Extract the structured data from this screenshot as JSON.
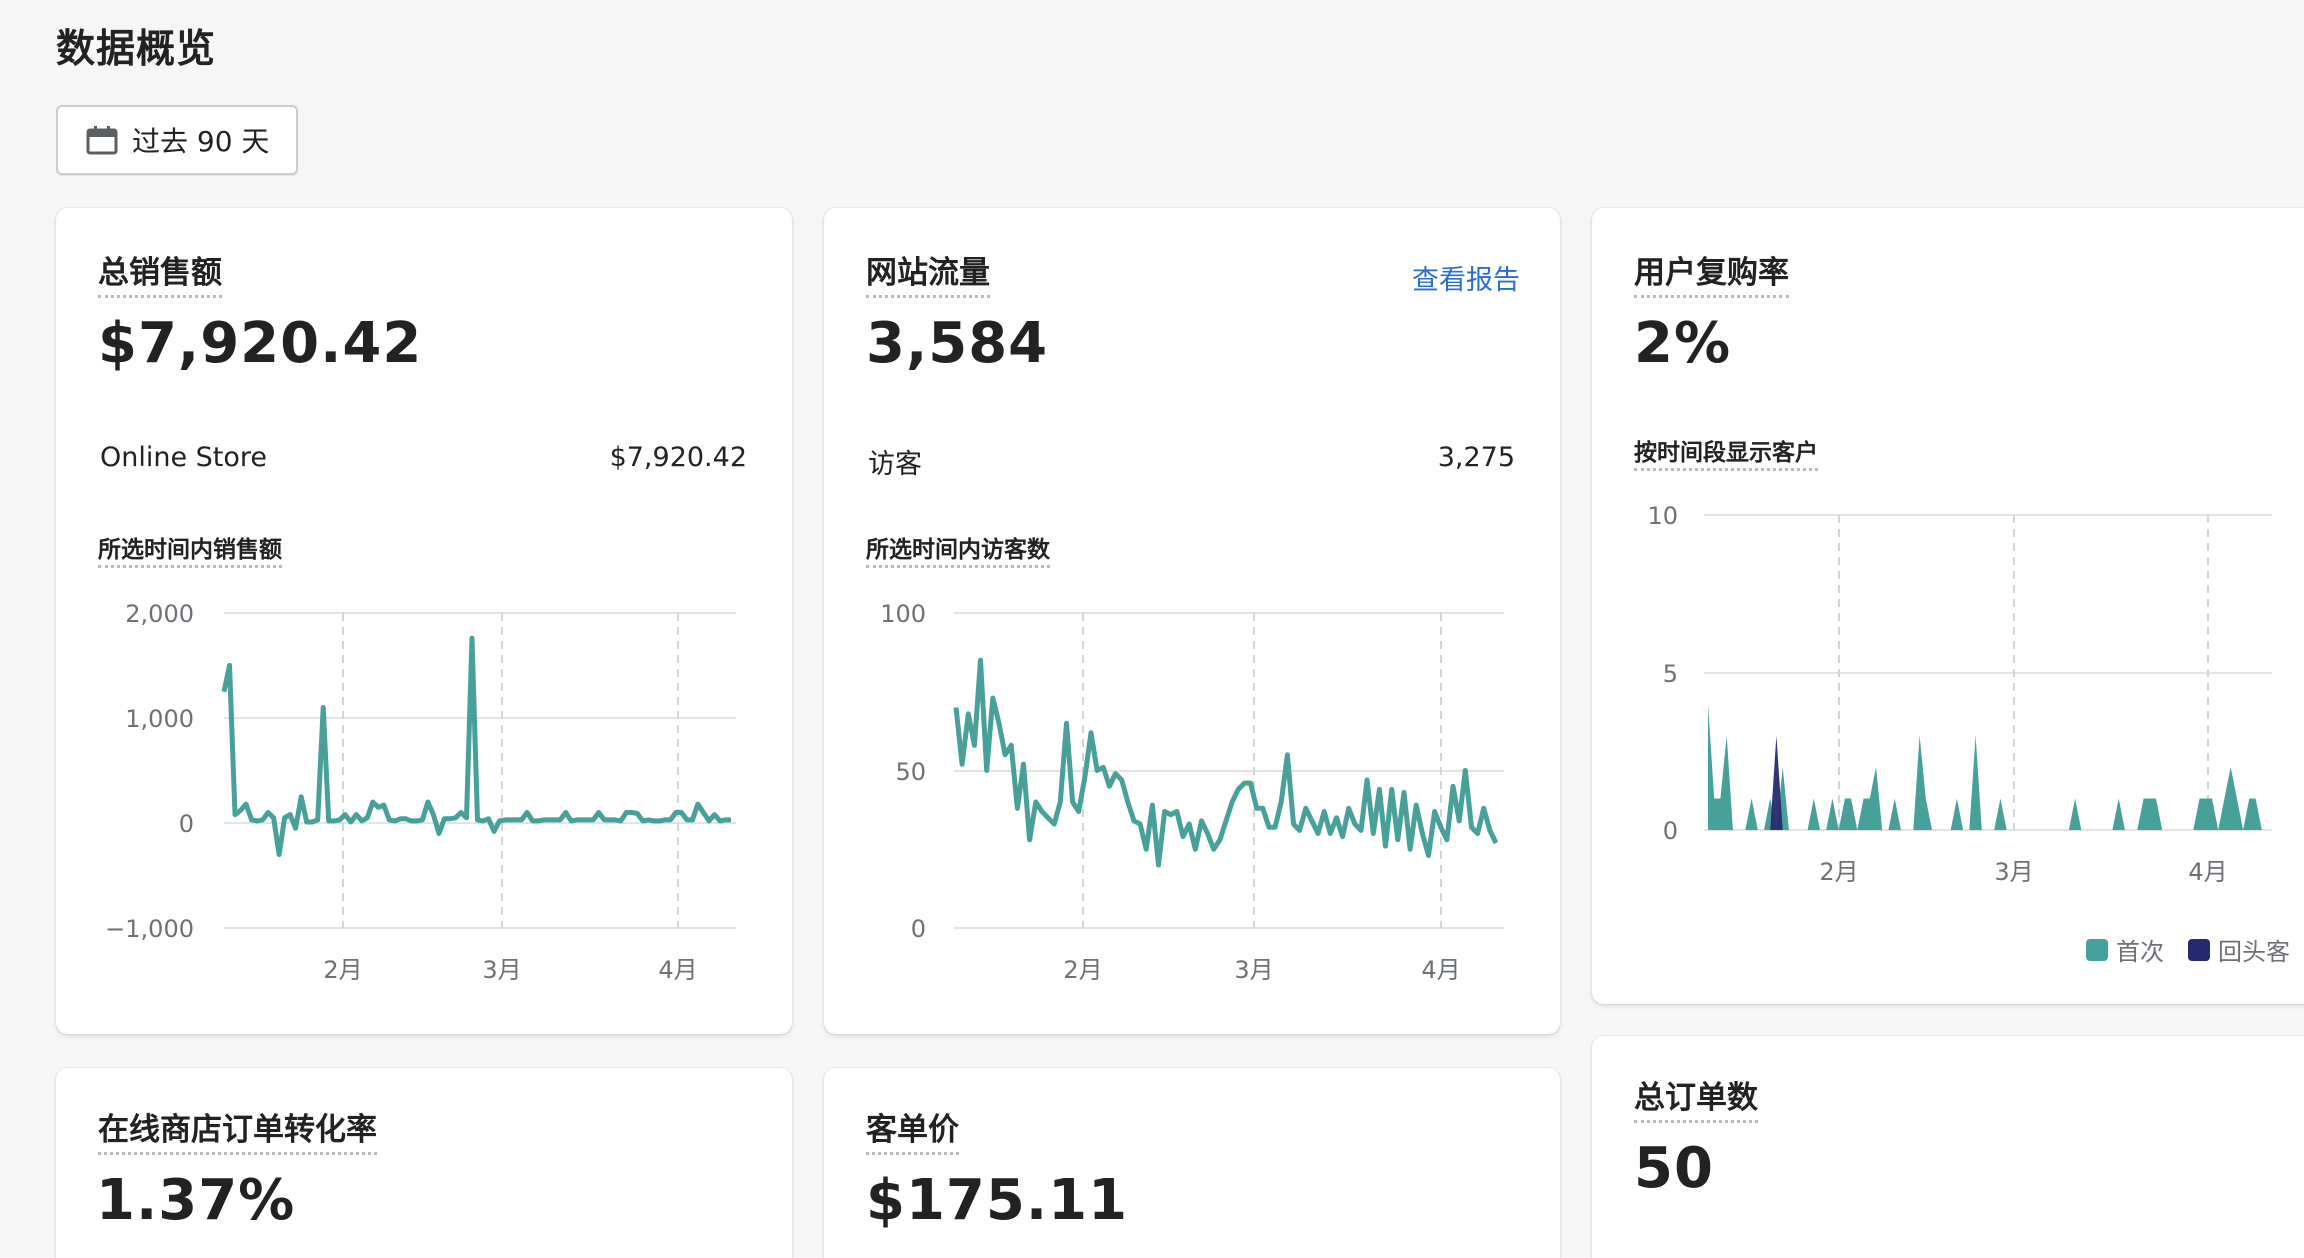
{
  "page": {
    "title": "数据概览",
    "date_range": "过去 90 天"
  },
  "colors": {
    "teal": "#47a09a",
    "navy": "#252a70",
    "link": "#2c6ecb"
  },
  "cards": {
    "sales": {
      "title": "总销售额",
      "value": "$7,920.42",
      "row_label": "Online Store",
      "row_value": "$7,920.42",
      "chart_title": "所选时间内销售额"
    },
    "traffic": {
      "title": "网站流量",
      "link": "查看报告",
      "value": "3,584",
      "row_label": "访客",
      "row_value": "3,275",
      "chart_title": "所选时间内访客数"
    },
    "repeat": {
      "title": "用户复购率",
      "value": "2%",
      "chart_title": "按时间段显示客户",
      "legend": [
        "首次",
        "回头客"
      ]
    },
    "conversion": {
      "title": "在线商店订单转化率",
      "value": "1.37%"
    },
    "aov": {
      "title": "客单价",
      "value": "$175.11"
    },
    "orders": {
      "title": "总订单数",
      "value": "50"
    }
  },
  "chart_data": [
    {
      "type": "line",
      "name_ref": "所选时间内销售额",
      "x_tick_labels": [
        "2月",
        "3月",
        "4月"
      ],
      "y_tick_labels": [
        "2,000",
        "1,000",
        "0",
        "−1,000"
      ],
      "ylim": [
        -1000,
        2000
      ],
      "grid": true,
      "values": [
        1250,
        1500,
        80,
        120,
        180,
        30,
        20,
        30,
        100,
        50,
        -300,
        50,
        80,
        -50,
        250,
        10,
        10,
        30,
        1100,
        20,
        20,
        30,
        80,
        10,
        80,
        20,
        50,
        200,
        150,
        170,
        30,
        20,
        40,
        40,
        20,
        20,
        30,
        200,
        80,
        -100,
        40,
        40,
        50,
        100,
        50,
        1760,
        30,
        20,
        40,
        -80,
        20,
        30,
        30,
        30,
        30,
        100,
        20,
        20,
        30,
        30,
        30,
        30,
        100,
        20,
        30,
        30,
        30,
        30,
        100,
        30,
        30,
        30,
        20,
        100,
        100,
        90,
        20,
        30,
        20,
        20,
        30,
        30,
        100,
        100,
        30,
        30,
        180,
        100,
        20,
        80,
        20,
        30,
        30
      ]
    },
    {
      "type": "line",
      "name_ref": "所选时间内访客数",
      "x_tick_labels": [
        "2月",
        "3月",
        "4月"
      ],
      "y_tick_labels": [
        "100",
        "50",
        "0"
      ],
      "ylim": [
        0,
        100
      ],
      "grid": true,
      "values": [
        70,
        52,
        68,
        58,
        85,
        50,
        73,
        65,
        55,
        58,
        38,
        52,
        28,
        40,
        37,
        35,
        33,
        40,
        65,
        40,
        37,
        48,
        62,
        50,
        51,
        45,
        49,
        47,
        40,
        34,
        33,
        25,
        39,
        20,
        37,
        36,
        37,
        29,
        33,
        25,
        34,
        30,
        25,
        28,
        34,
        40,
        44,
        46,
        46,
        38,
        38,
        32,
        32,
        40,
        55,
        33,
        31,
        38,
        34,
        30,
        37,
        30,
        35,
        29,
        38,
        33,
        31,
        47,
        30,
        44,
        26,
        44,
        28,
        43,
        25,
        39,
        30,
        23,
        37,
        32,
        28,
        45,
        34,
        50,
        32,
        30,
        38,
        31,
        27
      ]
    },
    {
      "type": "area",
      "name_ref": "按时间段显示客户",
      "x_tick_labels": [
        "2月",
        "3月",
        "4月"
      ],
      "y_tick_labels": [
        "10",
        "5",
        "0"
      ],
      "ylim": [
        0,
        10
      ],
      "grid": true,
      "series": [
        {
          "name": "首次",
          "values": [
            4,
            1,
            1,
            3,
            0,
            0,
            0,
            1,
            0,
            0,
            1,
            0,
            2,
            0,
            0,
            0,
            0,
            1,
            0,
            0,
            1,
            0,
            1,
            1,
            0,
            1,
            1,
            2,
            0,
            0,
            1,
            0,
            0,
            0,
            3,
            1,
            0,
            0,
            0,
            0,
            1,
            0,
            0,
            3,
            0,
            0,
            0,
            1,
            0,
            0,
            0,
            0,
            0,
            0,
            0,
            0,
            0,
            0,
            0,
            1,
            0,
            0,
            0,
            0,
            0,
            0,
            1,
            0,
            0,
            0,
            1,
            1,
            1,
            0,
            0,
            0,
            0,
            0,
            0,
            1,
            1,
            1,
            0,
            1,
            2,
            1,
            0,
            1,
            1,
            0,
            0
          ]
        },
        {
          "name": "回头客",
          "values": [
            0,
            0,
            0,
            0,
            0,
            0,
            0,
            0,
            0,
            0,
            0,
            3,
            0,
            0,
            0,
            0,
            0,
            0,
            0,
            0,
            0,
            0,
            0,
            0,
            0,
            0,
            0,
            0,
            0,
            0,
            0,
            0,
            0,
            0,
            0,
            0,
            0,
            0,
            0,
            0,
            0,
            0,
            0,
            0,
            0,
            0,
            0,
            0,
            0,
            0,
            0,
            0,
            0,
            0,
            0,
            0,
            0,
            0,
            0,
            0,
            0,
            0,
            0,
            0,
            0,
            0,
            0,
            0,
            0,
            0,
            0,
            0,
            0,
            0,
            0,
            0,
            0,
            0,
            0,
            0,
            0,
            0,
            0,
            0,
            0,
            0,
            0,
            0,
            0,
            0,
            0
          ]
        }
      ]
    }
  ]
}
